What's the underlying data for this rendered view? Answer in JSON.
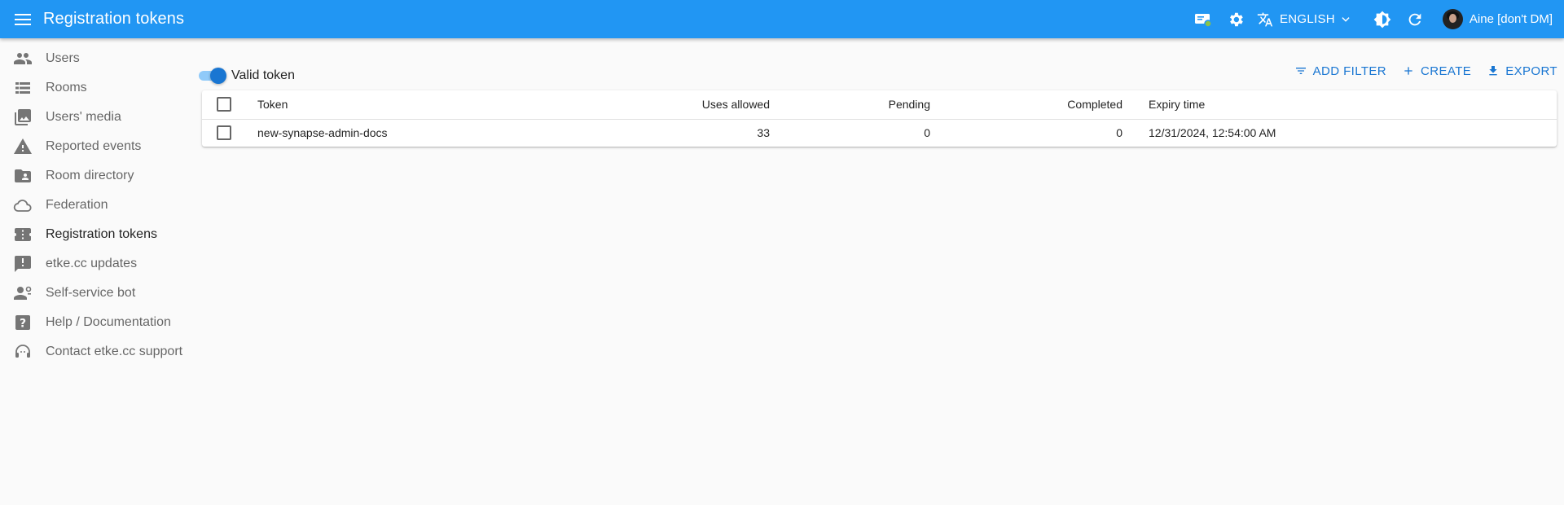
{
  "app": {
    "title": "Registration tokens"
  },
  "header": {
    "language": "ENGLISH",
    "user_name": "Aine [don't DM]",
    "icons": [
      "menu-icon",
      "server-status-icon",
      "settings-icon",
      "translate-icon",
      "chevron-down-icon",
      "theme-icon",
      "refresh-icon"
    ]
  },
  "sidebar": {
    "items": [
      {
        "label": "Users",
        "icon": "people-icon"
      },
      {
        "label": "Rooms",
        "icon": "list-icon"
      },
      {
        "label": "Users' media",
        "icon": "photo-library-icon"
      },
      {
        "label": "Reported events",
        "icon": "warning-icon"
      },
      {
        "label": "Room directory",
        "icon": "folder-shared-icon"
      },
      {
        "label": "Federation",
        "icon": "cloud-icon"
      },
      {
        "label": "Registration tokens",
        "icon": "ticket-icon",
        "active": true
      },
      {
        "label": "etke.cc updates",
        "icon": "announcement-icon"
      },
      {
        "label": "Self-service bot",
        "icon": "support-agent-icon"
      },
      {
        "label": "Help / Documentation",
        "icon": "help-icon"
      },
      {
        "label": "Contact etke.cc support",
        "icon": "headset-icon"
      }
    ]
  },
  "toolbar": {
    "switch_label": "Valid token",
    "switch_on": true,
    "add_filter": "ADD FILTER",
    "create": "CREATE",
    "export": "EXPORT"
  },
  "table": {
    "columns": [
      "Token",
      "Uses allowed",
      "Pending",
      "Completed",
      "Expiry time"
    ],
    "rows": [
      {
        "token": "new-synapse-admin-docs",
        "uses_allowed": "33",
        "pending": "0",
        "completed": "0",
        "expiry_time": "12/31/2024, 12:54:00 AM"
      }
    ]
  },
  "colors": {
    "primary": "#2196f3",
    "accent": "#1976d2"
  }
}
